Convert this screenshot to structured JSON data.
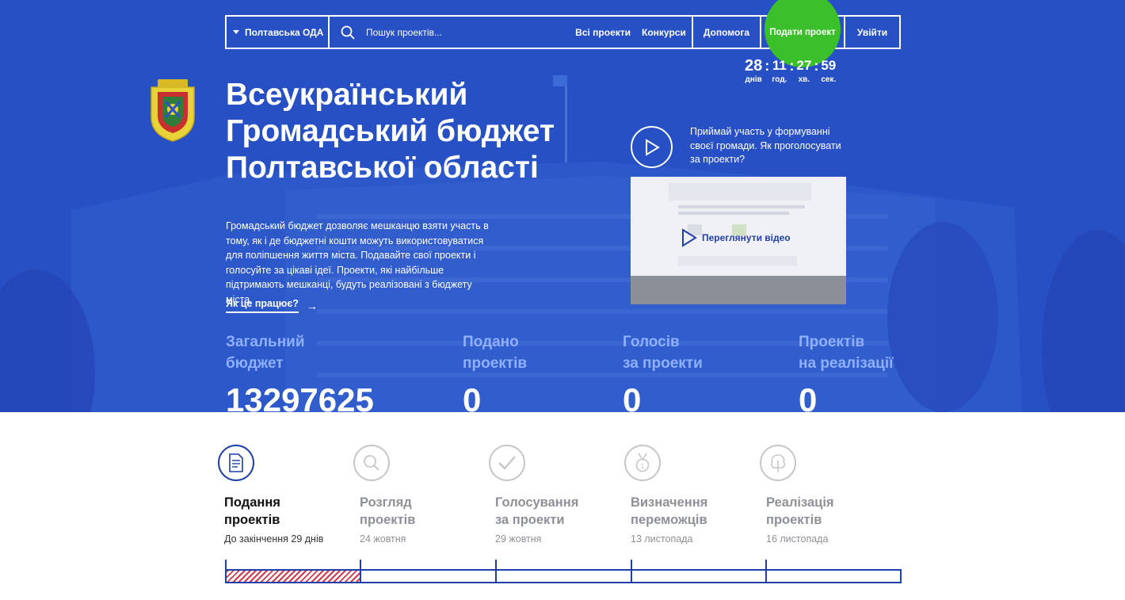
{
  "nav": {
    "region_label": "Полтавська ОДА",
    "search_placeholder": "Пошук проектів...",
    "links": [
      "Всі проекти",
      "Конкурси",
      "Допомога"
    ],
    "submit_label": "Подати проект",
    "logout_label": "Увійти"
  },
  "countdown": {
    "days": "28",
    "days_label": "днів",
    "hours": "11",
    "hours_label": "год.",
    "minutes": "27",
    "minutes_label": "хв.",
    "seconds": "59",
    "seconds_label": "сек."
  },
  "hero": {
    "title_line1": "Всеукраїнський",
    "title_line2": "Громадський бюджет",
    "title_line3": "Полтавської області",
    "description": "Громадський бюджет дозволяє мешканцю взяти участь в тому, як і де бюджетні кошти можуть використовуватися для поліпшення життя міста. Подавайте свої проекти і голосуйте за цікаві ідеї. Проекти, які найбільше підтримають мешканці, будуть реалізовані з бюджету міста.",
    "how_it_works": "Як це працює?",
    "video_intro": "Приймай участь у формуванні своєї громади. Як проголосувати за проекти?",
    "video_label": "Переглянути відео"
  },
  "stats": [
    {
      "label_line1": "Загальний",
      "label_line2": "бюджет",
      "value": "13297625"
    },
    {
      "label_line1": "Подано",
      "label_line2": "проектів",
      "value": "0"
    },
    {
      "label_line1": "Голосів",
      "label_line2": "за проекти",
      "value": "0"
    },
    {
      "label_line1": "Проектів",
      "label_line2": "на реалізації",
      "value": "0"
    }
  ],
  "steps": [
    {
      "title_line1": "Подання",
      "title_line2": "проектів",
      "date": "До закінчення 29 днів"
    },
    {
      "title_line1": "Розгляд",
      "title_line2": "проектів",
      "date": "24 жовтня"
    },
    {
      "title_line1": "Голосування",
      "title_line2": "за проекти",
      "date": "29 жовтня"
    },
    {
      "title_line1": "Визначення",
      "title_line2": "переможців",
      "date": "13 листопада"
    },
    {
      "title_line1": "Реалізація",
      "title_line2": "проектів",
      "date": "16 листопада"
    }
  ],
  "progress": {
    "current_step": 1,
    "total_steps": 5
  },
  "colors": {
    "hero_blue": "#2650c4",
    "accent_green": "#3bbf2a",
    "nav_blue": "#1f3ea7",
    "stat_label": "#8fb0ff",
    "progress_hatch": "#d03a4a"
  }
}
